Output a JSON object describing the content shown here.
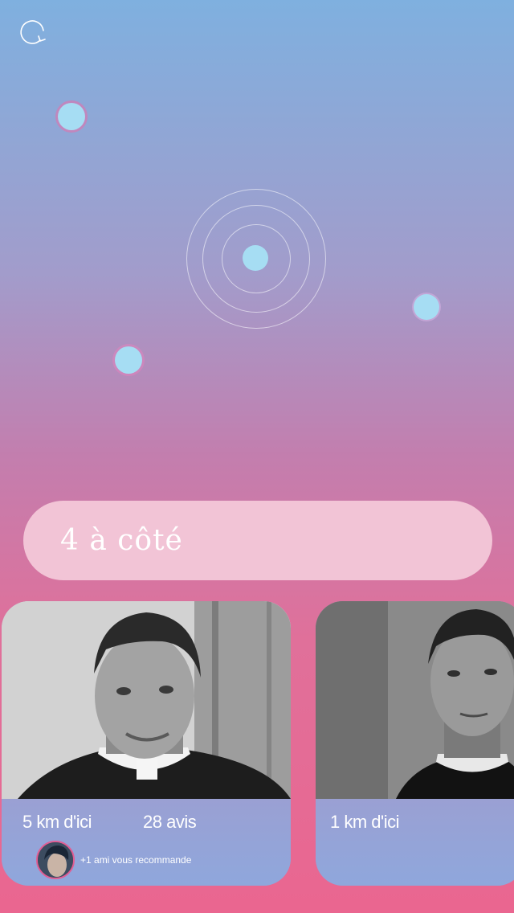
{
  "header": {
    "refresh_icon": "refresh-icon"
  },
  "radar": {
    "dot_color": "#a6ddf3",
    "ring_color": "#ffffff"
  },
  "summary": {
    "count_text": "4 à côté"
  },
  "profiles": [
    {
      "distance": "5 km d'ici",
      "reviews": "28 avis",
      "recommendation": "+1 ami vous recommande"
    },
    {
      "distance": "1 km d'ici"
    }
  ],
  "colors": {
    "gradient_top": "#7fb0df",
    "gradient_bottom": "#ea6690",
    "pill": "#f2c4d6",
    "card_info": "#8fa7dc",
    "accent_pink": "#e15d93"
  }
}
